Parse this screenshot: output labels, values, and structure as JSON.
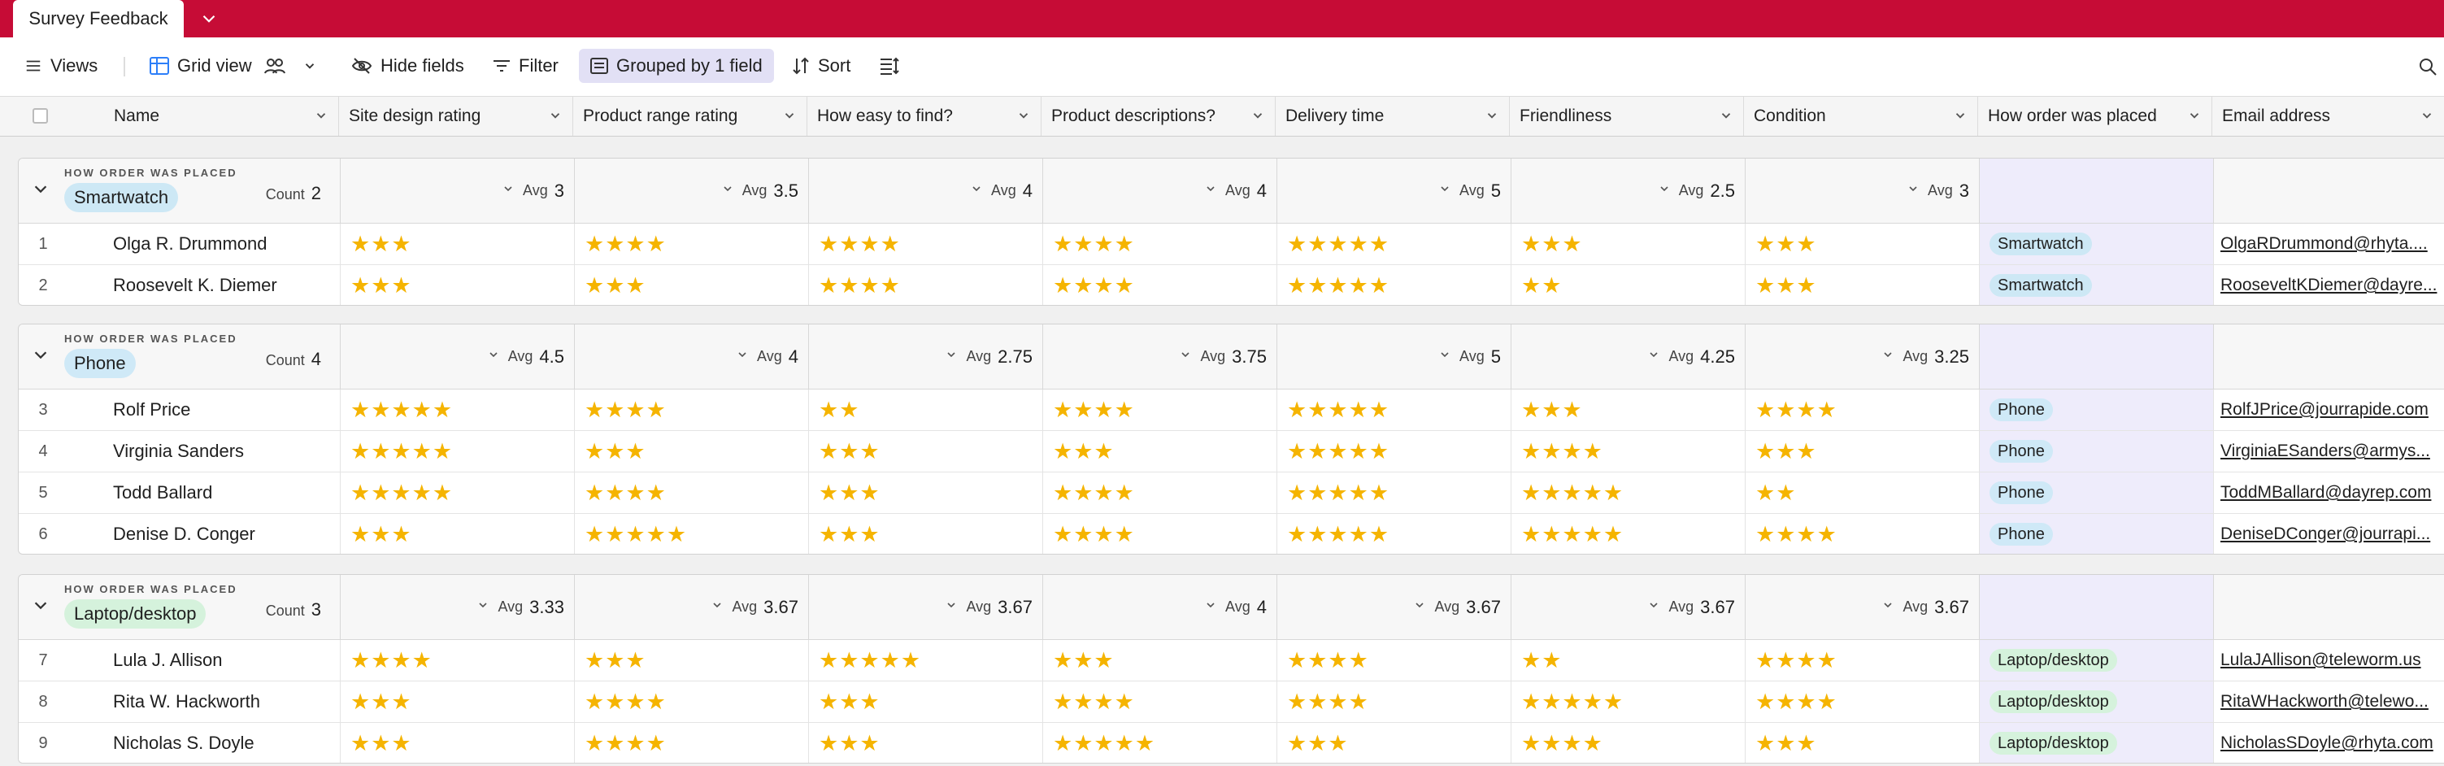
{
  "tab": {
    "title": "Survey Feedback"
  },
  "toolbar": {
    "views": "Views",
    "grid_view": "Grid view",
    "hide_fields": "Hide fields",
    "filter": "Filter",
    "grouped": "Grouped by 1 field",
    "sort": "Sort"
  },
  "columns": [
    "Name",
    "Site design rating",
    "Product range rating",
    "How easy to find?",
    "Product descriptions?",
    "Delivery time",
    "Friendliness",
    "Condition",
    "How order was placed",
    "Email address"
  ],
  "group_label": "HOW ORDER WAS PLACED",
  "count_label": "Count",
  "avg_label": "Avg",
  "star_glyph": "★",
  "colors": {
    "accent": "#c60c36",
    "star": "#f5b400",
    "smartwatch": "#cde8f5",
    "phone": "#cfe9f7",
    "laptop": "#d5f2dc"
  },
  "groups": [
    {
      "name": "Smartwatch",
      "count": "2",
      "color": "#cde8f5",
      "averages": [
        "3",
        "3.5",
        "4",
        "4",
        "5",
        "2.5",
        "3"
      ],
      "rows": [
        {
          "num": "1",
          "name": "Olga R. Drummond",
          "ratings": [
            3,
            4,
            4,
            4,
            5,
            3,
            3
          ],
          "order": "Smartwatch",
          "email": "OlgaRDrummond@rhyta...."
        },
        {
          "num": "2",
          "name": "Roosevelt K. Diemer",
          "ratings": [
            3,
            3,
            4,
            4,
            5,
            2,
            3
          ],
          "order": "Smartwatch",
          "email": "RooseveltKDiemer@dayre..."
        }
      ]
    },
    {
      "name": "Phone",
      "count": "4",
      "color": "#cfe9f7",
      "averages": [
        "4.5",
        "4",
        "2.75",
        "3.75",
        "5",
        "4.25",
        "3.25"
      ],
      "rows": [
        {
          "num": "3",
          "name": "Rolf Price",
          "ratings": [
            5,
            4,
            2,
            4,
            5,
            3,
            4
          ],
          "order": "Phone",
          "email": "RolfJPrice@jourrapide.com"
        },
        {
          "num": "4",
          "name": "Virginia Sanders",
          "ratings": [
            5,
            3,
            3,
            3,
            5,
            4,
            3
          ],
          "order": "Phone",
          "email": "VirginiaESanders@armys..."
        },
        {
          "num": "5",
          "name": "Todd Ballard",
          "ratings": [
            5,
            4,
            3,
            4,
            5,
            5,
            2
          ],
          "order": "Phone",
          "email": "ToddMBallard@dayrep.com"
        },
        {
          "num": "6",
          "name": "Denise D. Conger",
          "ratings": [
            3,
            5,
            3,
            4,
            5,
            5,
            4
          ],
          "order": "Phone",
          "email": "DeniseDConger@jourrapi..."
        }
      ]
    },
    {
      "name": "Laptop/desktop",
      "count": "3",
      "color": "#d5f2dc",
      "averages": [
        "3.33",
        "3.67",
        "3.67",
        "4",
        "3.67",
        "3.67",
        "3.67"
      ],
      "rows": [
        {
          "num": "7",
          "name": "Lula J. Allison",
          "ratings": [
            4,
            3,
            5,
            3,
            4,
            2,
            4
          ],
          "order": "Laptop/desktop",
          "email": "LulaJAllison@teleworm.us"
        },
        {
          "num": "8",
          "name": "Rita W. Hackworth",
          "ratings": [
            3,
            4,
            3,
            4,
            4,
            5,
            4
          ],
          "order": "Laptop/desktop",
          "email": "RitaWHackworth@telewo..."
        },
        {
          "num": "9",
          "name": "Nicholas S. Doyle",
          "ratings": [
            3,
            4,
            3,
            5,
            3,
            4,
            3
          ],
          "order": "Laptop/desktop",
          "email": "NicholasSDoyle@rhyta.com"
        }
      ]
    }
  ]
}
